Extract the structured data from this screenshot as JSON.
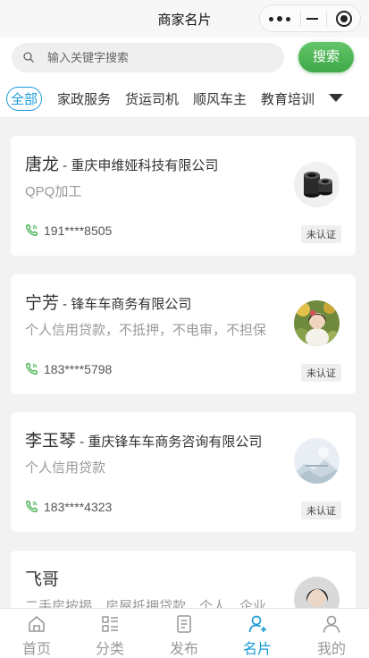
{
  "nav": {
    "title": "商家名片"
  },
  "search": {
    "placeholder": "输入关键字搜索",
    "button_label": "搜索"
  },
  "tabs": [
    {
      "label": "全部",
      "active": true
    },
    {
      "label": "家政服务"
    },
    {
      "label": "货运司机"
    },
    {
      "label": "顺风车主"
    },
    {
      "label": "教育培训"
    }
  ],
  "cards": [
    {
      "name": "唐龙",
      "separator": " - ",
      "company": "重庆申维娅科技有限公司",
      "desc": "QPQ加工",
      "phone": "191****8505",
      "badge": "未认证",
      "avatar": "product-photo"
    },
    {
      "name": "宁芳",
      "separator": " - ",
      "company": "锋车车商务有限公司",
      "desc": "个人信用贷款，不抵押，不电审，不担保",
      "phone": "183****5798",
      "badge": "未认证",
      "avatar": "person-photo"
    },
    {
      "name": "李玉琴",
      "separator": " - ",
      "company": "重庆锋车车商务咨询有限公司",
      "desc": "个人信用贷款",
      "phone": "183****4323",
      "badge": "未认证",
      "avatar": "landscape-photo"
    },
    {
      "name": "飞哥",
      "separator": "",
      "company": "",
      "desc": "二手房按揭、房屋抵押贷款、个人、企业",
      "phone": "",
      "badge": "",
      "avatar": "person-photo"
    }
  ],
  "tabbar": [
    {
      "label": "首页",
      "icon": "home-icon"
    },
    {
      "label": "分类",
      "icon": "category-icon"
    },
    {
      "label": "发布",
      "icon": "publish-icon"
    },
    {
      "label": "名片",
      "icon": "card-icon",
      "active": true
    },
    {
      "label": "我的",
      "icon": "user-icon"
    }
  ],
  "colors": {
    "accent": "#1a9bd8",
    "search_button": "#4cb454",
    "phone_icon": "#4cb454"
  }
}
